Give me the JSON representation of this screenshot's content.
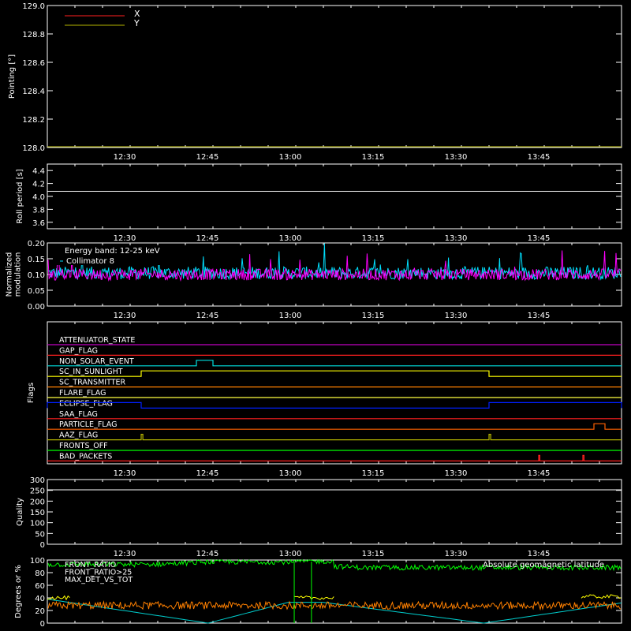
{
  "x_axis": {
    "range_min": [
      12,
      16
    ],
    "ticks": [
      {
        "t": [
          12,
          30
        ],
        "label": "12:30"
      },
      {
        "t": [
          12,
          45
        ],
        "label": "12:45"
      },
      {
        "t": [
          13,
          0
        ],
        "label": "13:00"
      },
      {
        "t": [
          13,
          15
        ],
        "label": "13:15"
      },
      {
        "t": [
          13,
          30
        ],
        "label": "13:30"
      },
      {
        "t": [
          13,
          45
        ],
        "label": "13:45"
      }
    ]
  },
  "chart_data": [
    {
      "id": "pointing",
      "type": "line",
      "ylabel": "Pointing [°]",
      "ylim": [
        128.0,
        129.0
      ],
      "yticks": [
        "128.0",
        "128.2",
        "128.4",
        "128.6",
        "128.8",
        "129.0"
      ],
      "series": [
        {
          "name": "X",
          "color": "#ff2020",
          "values": []
        },
        {
          "name": "Y",
          "color": "#b4b400",
          "values": [
            128.0,
            128.0
          ]
        }
      ]
    },
    {
      "id": "roll",
      "type": "line",
      "ylabel": "Roll period [s]",
      "ylim": [
        3.5,
        4.5
      ],
      "yticks": [
        "3.6",
        "3.8",
        "4.0",
        "4.2",
        "4.4"
      ],
      "series": [
        {
          "color": "#ffffff",
          "values": [
            4.08,
            4.08
          ]
        }
      ]
    },
    {
      "id": "modulation",
      "type": "line",
      "ylabel": [
        "Normalized",
        "modulation"
      ],
      "ylim": [
        0,
        0.2
      ],
      "yticks": [
        "0.00",
        "0.05",
        "0.10",
        "0.15",
        "0.20"
      ],
      "annotation": "Energy band: 12-25 keV",
      "series": [
        {
          "name": "Collimator 8",
          "color": "#00e0ff",
          "mean": 0.105,
          "spread": 0.02
        },
        {
          "color": "#ff00ff",
          "mean": 0.1,
          "spread": 0.018
        }
      ]
    },
    {
      "id": "flags",
      "type": "line",
      "ylabel": "Flags",
      "flags": [
        {
          "name": "ATTENUATOR_STATE",
          "color": "#c000c0",
          "on": []
        },
        {
          "name": "GAP_FLAG",
          "color": "#ff2020",
          "on": []
        },
        {
          "name": "NON_SOLAR_EVENT",
          "color": "#00e0e0",
          "on": [
            [
              [
                12,
                43
              ],
              [
                12,
                46
              ]
            ]
          ]
        },
        {
          "name": "SC_IN_SUNLIGHT",
          "color": "#ffff00",
          "on": [
            [
              [
                12,
                33
              ],
              [
                13,
                36
              ]
            ]
          ]
        },
        {
          "name": "SC_TRANSMITTER",
          "color": "#ff8000",
          "on": []
        },
        {
          "name": "FLARE_FLAG",
          "color": "#ffff40",
          "on": []
        },
        {
          "name": "ECLIPSE_FLAG",
          "color": "#0020ff",
          "on": [
            [
              [
                12,
                16
              ],
              [
                12,
                33
              ]
            ],
            [
              [
                13,
                36
              ],
              [
                14,
                0
              ]
            ]
          ]
        },
        {
          "name": "SAA_FLAG",
          "color": "#ff2020",
          "on": []
        },
        {
          "name": "PARTICLE_FLAG",
          "color": "#ff6000",
          "on": [
            [
              [
                13,
                55
              ],
              [
                13,
                57
              ]
            ]
          ]
        },
        {
          "name": "AAZ_FLAG",
          "color": "#b4b400",
          "on": [
            [
              [
                12,
                33
              ],
              [
                12,
                33.3
              ]
            ],
            [
              [
                13,
                36
              ],
              [
                13,
                36.3
              ]
            ]
          ]
        },
        {
          "name": "FRONTS_OFF",
          "color": "#00ff00",
          "on": []
        },
        {
          "name": "BAD_PACKETS",
          "color": "#ff2020",
          "on": [
            [
              [
                13,
                45
              ],
              [
                13,
                45.2
              ]
            ],
            [
              [
                13,
                53
              ],
              [
                13,
                53.2
              ]
            ]
          ]
        }
      ]
    },
    {
      "id": "quality",
      "type": "line",
      "ylabel": "Quality",
      "ylim": [
        0,
        300
      ],
      "yticks": [
        "0",
        "50",
        "100",
        "150",
        "200",
        "250",
        "300"
      ],
      "series": [
        {
          "color": "#ffffff",
          "values": [
            300,
            300
          ]
        }
      ]
    },
    {
      "id": "front",
      "type": "line",
      "ylabel": "Degrees or %",
      "ylim": [
        0,
        100
      ],
      "yticks": [
        "0",
        "20",
        "40",
        "60",
        "80",
        "100"
      ],
      "legend": [
        "FRONT_RATIO",
        "FRONT_RATIO>25",
        "MAX_DET_VS_TOT"
      ],
      "right_label": "Absolute geomagnetic latitude",
      "series": [
        {
          "name": "FRONT_RATIO",
          "color": "#00ff00"
        },
        {
          "name": "FRONT_RATIO>25",
          "color": "#ffff00"
        },
        {
          "name": "MAX_DET_VS_TOT",
          "color": "#ff8000"
        },
        {
          "name": "Absolute geomagnetic latitude",
          "color": "#00d0d0"
        }
      ]
    }
  ]
}
